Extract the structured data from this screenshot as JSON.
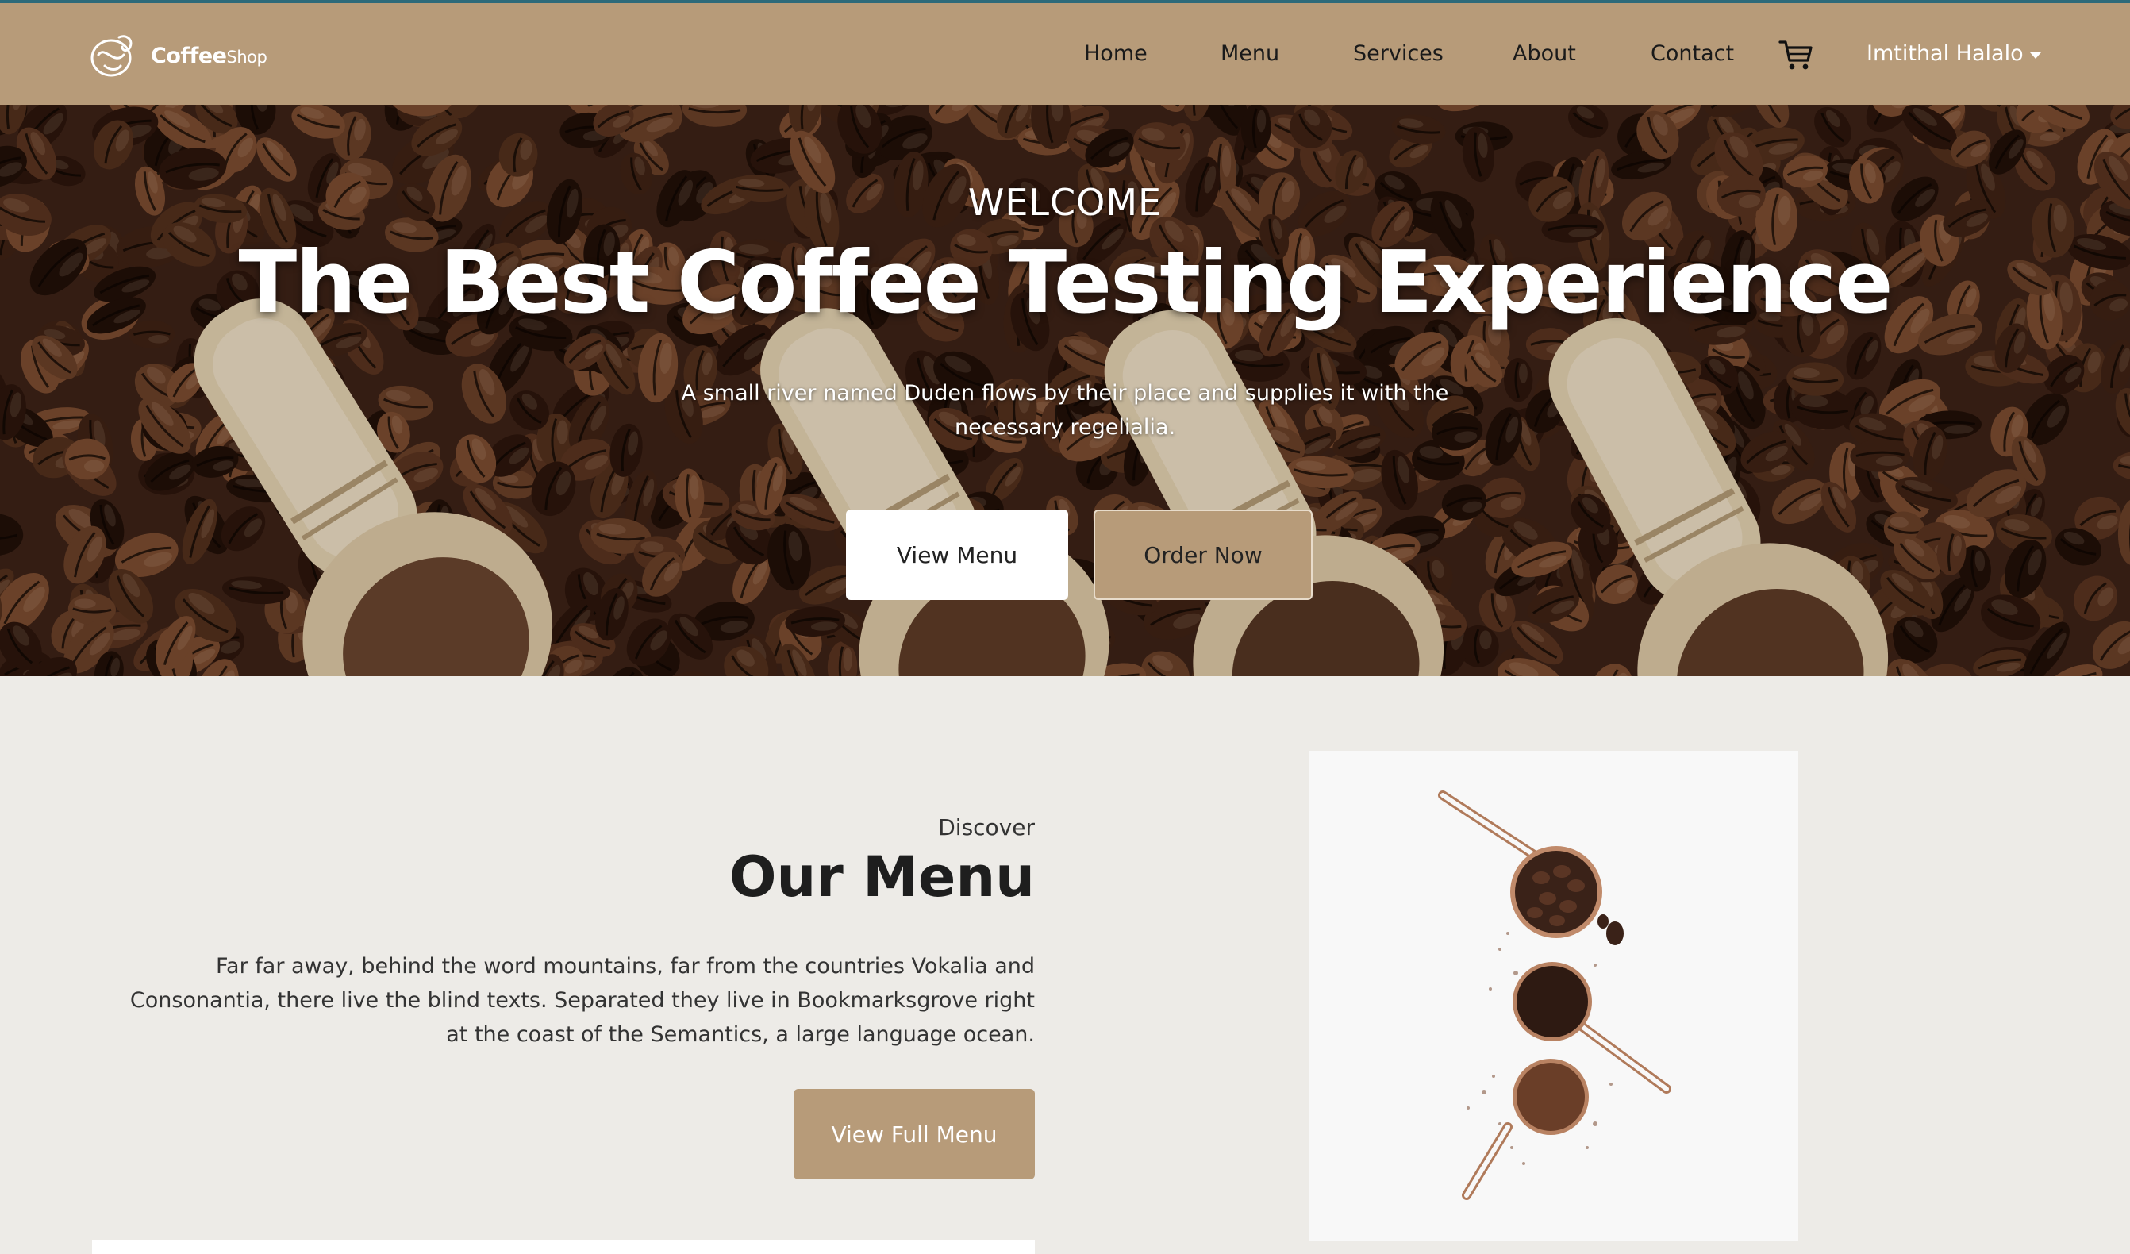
{
  "brand": {
    "name_bold": "Coffee",
    "name_small": "Shop",
    "logo_icon": "coffee-logo-icon"
  },
  "nav": {
    "items": [
      {
        "label": "Home"
      },
      {
        "label": "Menu"
      },
      {
        "label": "Services"
      },
      {
        "label": "About"
      },
      {
        "label": "Contact"
      }
    ],
    "cart_icon": "cart-icon",
    "user_name": "Imtithal Halalo"
  },
  "hero": {
    "kicker": "WELCOME",
    "title": "The Best Coffee Testing Experience",
    "subtitle": "A small river named Duden flows by their place and supplies it with the necessary regelialia.",
    "primary_button": "View Menu",
    "secondary_button": "Order Now"
  },
  "menu_section": {
    "eyebrow": "Discover",
    "title": "Our Menu",
    "text": "Far far away, behind the word mountains, far from the countries Vokalia and Consonantia, there live the blind texts. Separated they live in Bookmarksgrove right at the coast of the Semantics, a large language ocean.",
    "button": "View Full Menu"
  },
  "colors": {
    "accent": "#b79b79",
    "topline": "#2c6a7a",
    "background": "#edebe7"
  }
}
